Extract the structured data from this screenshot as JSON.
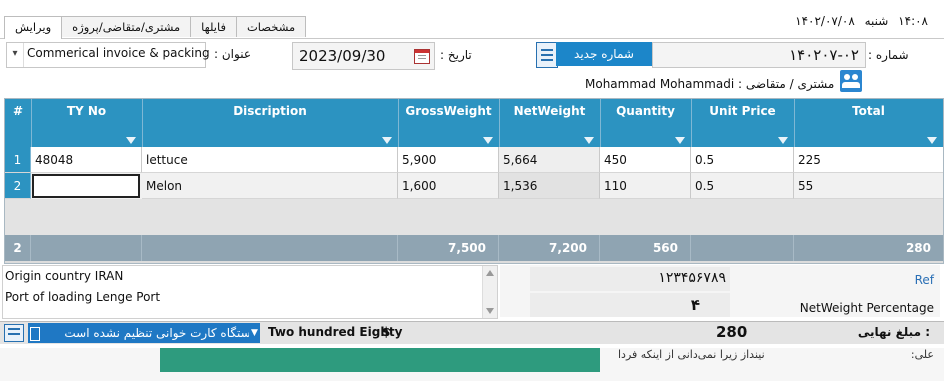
{
  "tabs": [
    "ویرایش",
    "مشتری/متقاضی/پروژه",
    "فایلها",
    "مشخصات"
  ],
  "clock": {
    "time": "۱۴:۰۸",
    "day": "شنبه",
    "date": "۱۴۰۲/۰۷/۰۸"
  },
  "header": {
    "title_label": "عنوان :",
    "title_value": "Commerical invoice & packing",
    "date_label": "تاریخ :",
    "date_value": "2023/09/30",
    "new_number_button": "شماره جدید",
    "number_label": "شماره :",
    "number_value": "۱۴۰۲۰۷-۰۲",
    "customer_label": "مشتری / متقاضی :",
    "customer_name": "Mohammad Mohammadi"
  },
  "grid": {
    "row_header_label": "#",
    "columns": [
      "TY No",
      "Discription",
      "GrossWeight",
      "NetWeight",
      "Quantity",
      "Unit Price",
      "Total"
    ],
    "rows": [
      {
        "n": "1",
        "cells": [
          "48048",
          "lettuce",
          "5,900",
          "5,664",
          "450",
          "0.5",
          "225"
        ]
      },
      {
        "n": "2",
        "cells": [
          "",
          "Melon",
          "1,600",
          "1,536",
          "110",
          "0.5",
          "55"
        ]
      }
    ],
    "footer": {
      "count": "2",
      "gross": "7,500",
      "net": "7,200",
      "qty": "560",
      "total": "280"
    }
  },
  "notes": {
    "line1": "Origin country IRAN",
    "line2": "Port of loading Lenge Port"
  },
  "right_panel": {
    "ref_label": "Ref",
    "ref_value": "۱۲۳۴۵۶۷۸۹",
    "netweight_label": "NetWeight Percentage",
    "netweight_value": "۴"
  },
  "status": {
    "card_reader": "دستگاه کارت خوانی تنظیم نشده است",
    "amount_words": "Two hundred Eighty",
    "currency_symbol": "$",
    "final_amount": "280",
    "final_label": ": مبلغ نهایی"
  },
  "torn_strip": {
    "text": "نینداز زیرا نمی‌دانی از اینکه فردا",
    "label_fragment": "علی:"
  },
  "colors": {
    "accent": "#1c86c9",
    "grid_header": "#2c93c1",
    "grid_footer": "#8fa4b2"
  }
}
